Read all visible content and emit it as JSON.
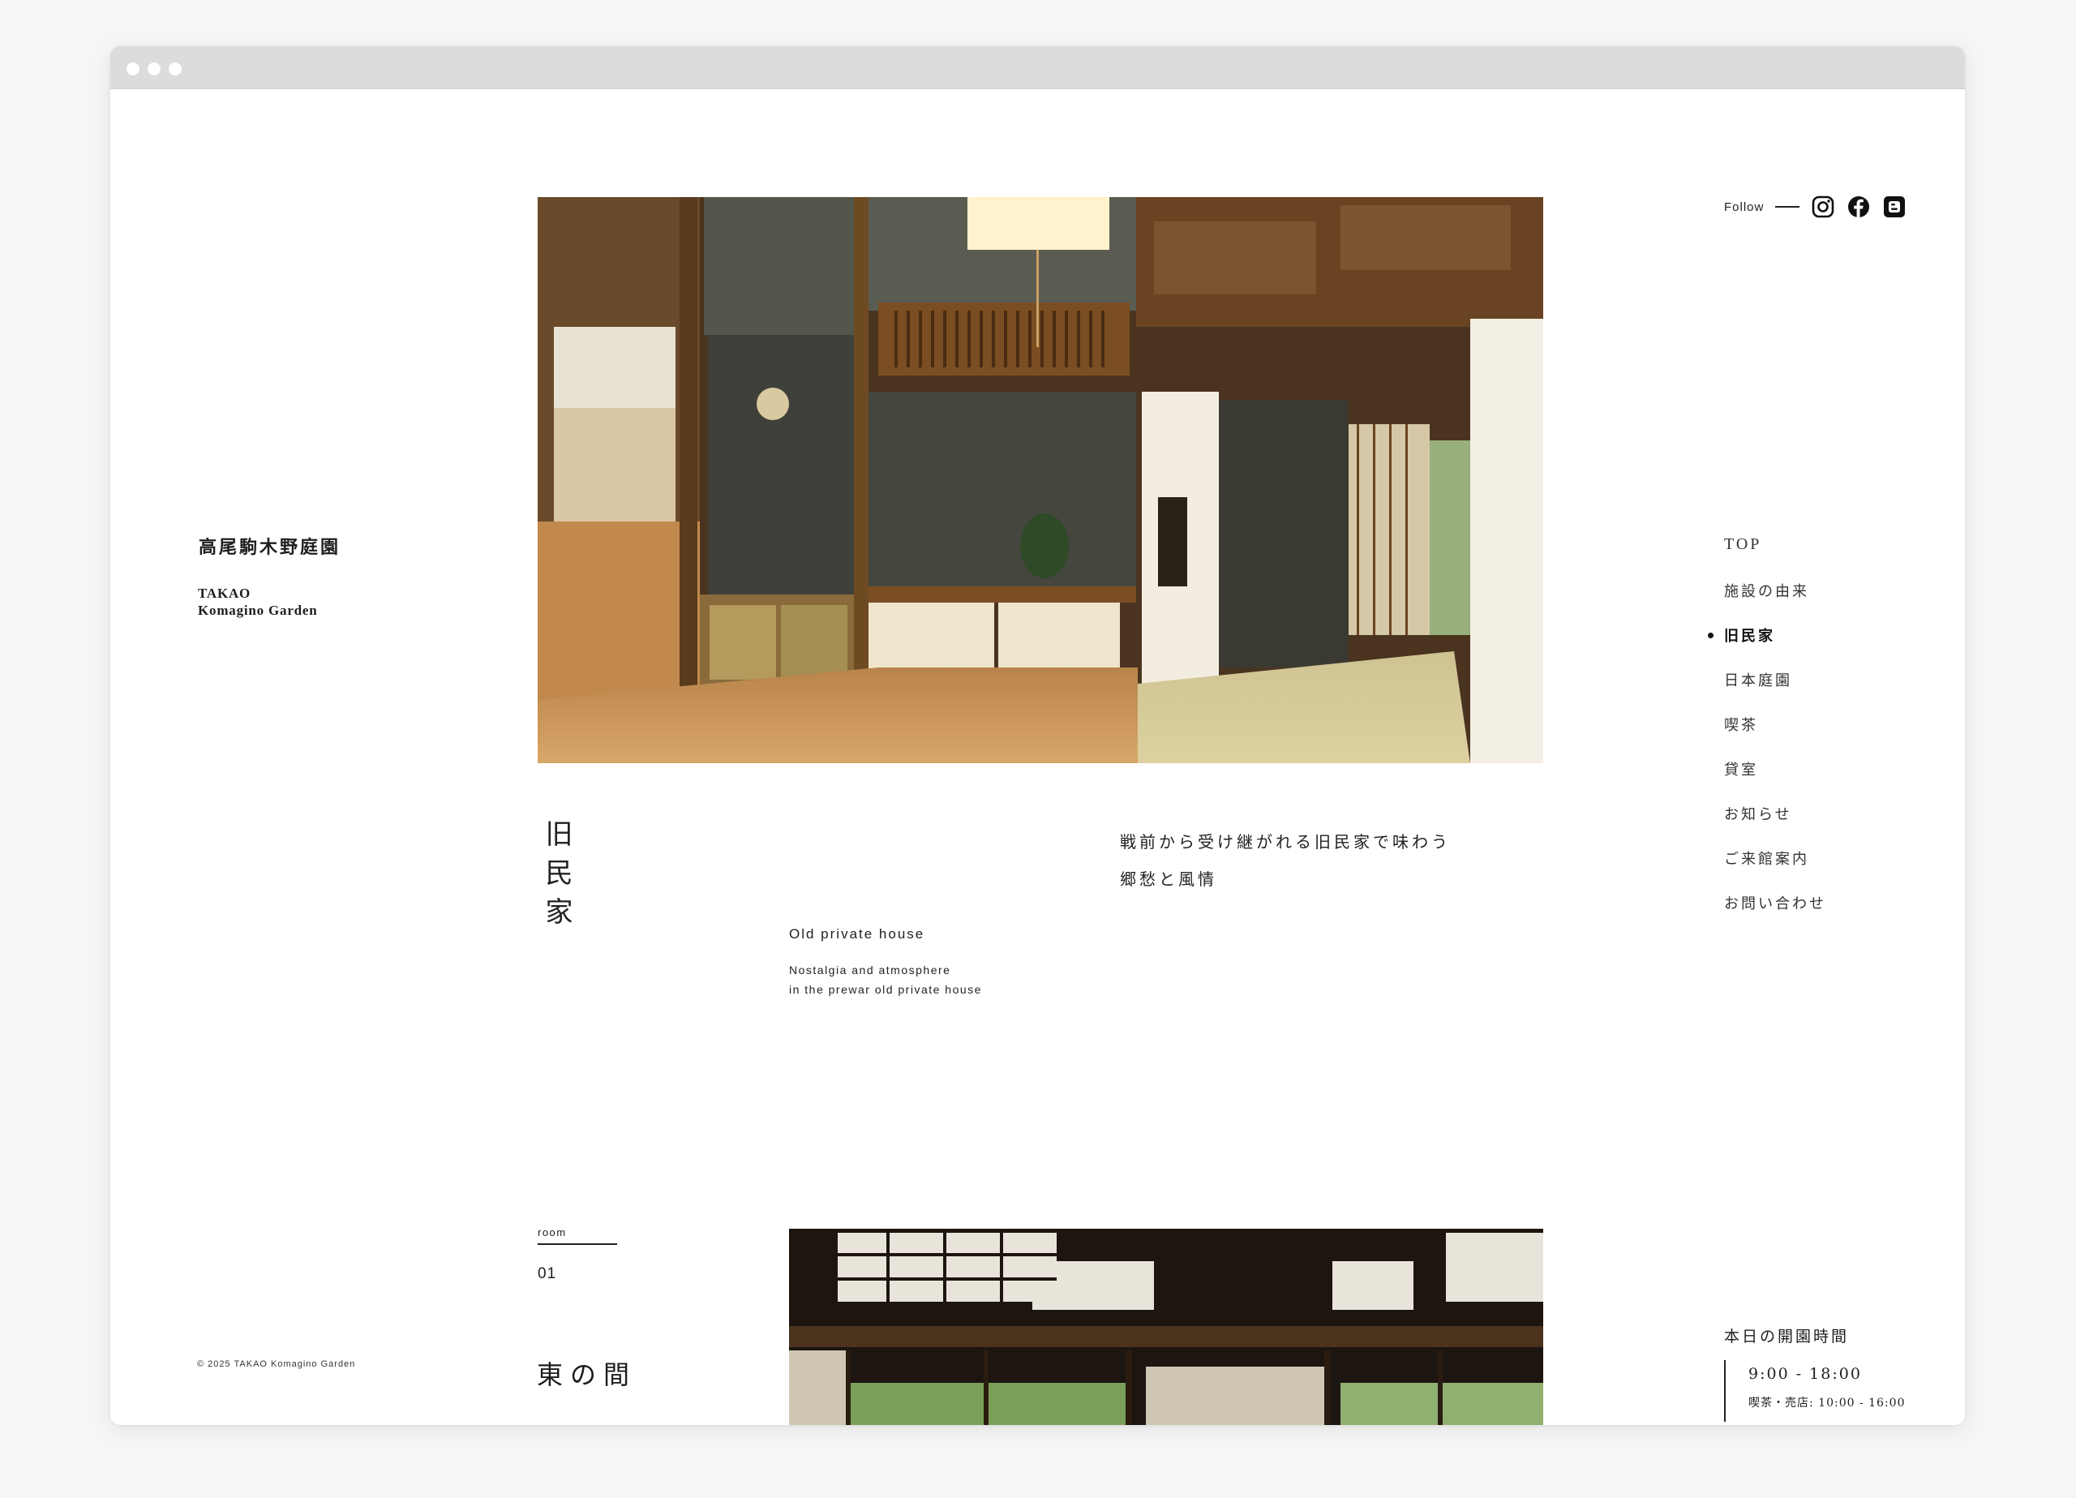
{
  "brand": {
    "name_jp": "高尾駒木野庭園",
    "name_en_line1": "TAKAO",
    "name_en_line2": "Komagino Garden"
  },
  "copyright": "© 2025 TAKAO Komagino Garden",
  "social": {
    "follow_label": "Follow",
    "icons": [
      "instagram-icon",
      "facebook-icon",
      "blogger-icon"
    ]
  },
  "nav": {
    "items": [
      {
        "label": "TOP"
      },
      {
        "label": "施設の由来"
      },
      {
        "label": "旧民家",
        "active": true
      },
      {
        "label": "日本庭園"
      },
      {
        "label": "喫茶"
      },
      {
        "label": "貸室"
      },
      {
        "label": "お知らせ"
      },
      {
        "label": "ご来館案内"
      },
      {
        "label": "お問い合わせ"
      }
    ]
  },
  "section": {
    "title_jp": "旧民家",
    "title_en": "Old private house",
    "subtitle_en_line1": "Nostalgia and atmosphere",
    "subtitle_en_line2": "in the prewar old private house",
    "lead_line1": "戦前から受け継がれる旧民家で味わう",
    "lead_line2": "郷愁と風情"
  },
  "room": {
    "label": "room",
    "number": "01",
    "name": "東の間"
  },
  "hours": {
    "title": "本日の開園時間",
    "main": "9:00 - 18:00",
    "sub": "喫茶・売店: 10:00 - 16:00"
  },
  "colors": {
    "page_bg": "#f6f6f6",
    "titlebar": "#dcdcdc",
    "text": "#1e1e1e"
  }
}
